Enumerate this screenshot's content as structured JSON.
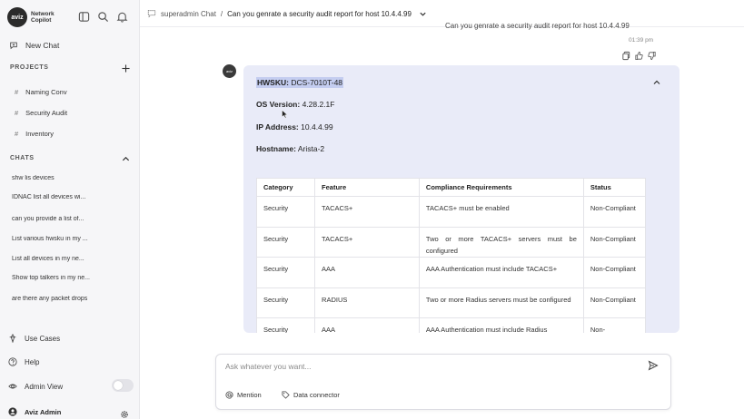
{
  "brand": {
    "logo_mark": "aviz",
    "name_line1": "Network",
    "name_line2": "Copilot"
  },
  "sidebar": {
    "new_chat_label": "New Chat",
    "projects_heading": "PROJECTS",
    "projects": [
      {
        "hash": "#",
        "label": "Naming Conv"
      },
      {
        "hash": "#",
        "label": "Security Audit"
      },
      {
        "hash": "#",
        "label": "Inventory"
      }
    ],
    "chats_heading": "CHATS",
    "chats": [
      "shw lis devices",
      "IDNAC list all devices wi...",
      "can you provide a list of...",
      "List various hwsku in my ...",
      "List all devices in my ne...",
      "Show top talkers in my ne...",
      "are there any packet drops"
    ],
    "use_cases_label": "Use Cases",
    "help_label": "Help",
    "admin_view_label": "Admin View",
    "admin_view_on": false,
    "user_name": "Aviz Admin"
  },
  "header": {
    "root_label": "superadmin Chat",
    "separator": "/",
    "current_chat": "Can you genrate a security audit report for host 10.4.4.99"
  },
  "previous_message": {
    "text": "Can you genrate a security audit report for host 10.4.4.99",
    "time": "01:39 pm"
  },
  "bot_avatar_text": "aviz",
  "report": {
    "hwsku_label": "HWSKU:",
    "hwsku_value": "DCS-7010T-48",
    "os_label": "OS Version:",
    "os_value": "4.28.2.1F",
    "ip_label": "IP Address:",
    "ip_value": "10.4.4.99",
    "host_label": "Hostname:",
    "host_value": "Arista-2",
    "table": {
      "headers": [
        "Category",
        "Feature",
        "Compliance Requirements",
        "Status"
      ],
      "rows": [
        [
          "Security",
          "TACACS+",
          "TACACS+ must be enabled",
          "Non-Compliant"
        ],
        [
          "Security",
          "TACACS+",
          "Two or more TACACS+ servers must be configured",
          "Non-Compliant"
        ],
        [
          "Security",
          "AAA",
          "AAA Authentication must include TACACS+",
          "Non-Compliant"
        ],
        [
          "Security",
          "RADIUS",
          "Two or more Radius servers must be configured",
          "Non-Compliant"
        ],
        [
          "Security",
          "AAA",
          "AAA Authentication must include Radius",
          "Non-"
        ]
      ]
    }
  },
  "composer": {
    "placeholder": "Ask whatever you want...",
    "mention_label": "Mention",
    "connector_label": "Data connector"
  },
  "icons": {
    "sidebar_toggle": "sidebar-toggle-icon",
    "search": "search-icon",
    "bell": "bell-icon",
    "send": "send-icon"
  },
  "colors": {
    "card_bg": "#e9ebf8",
    "highlight": "#c4cdf0",
    "sidebar_bg": "#f6f6f8"
  }
}
